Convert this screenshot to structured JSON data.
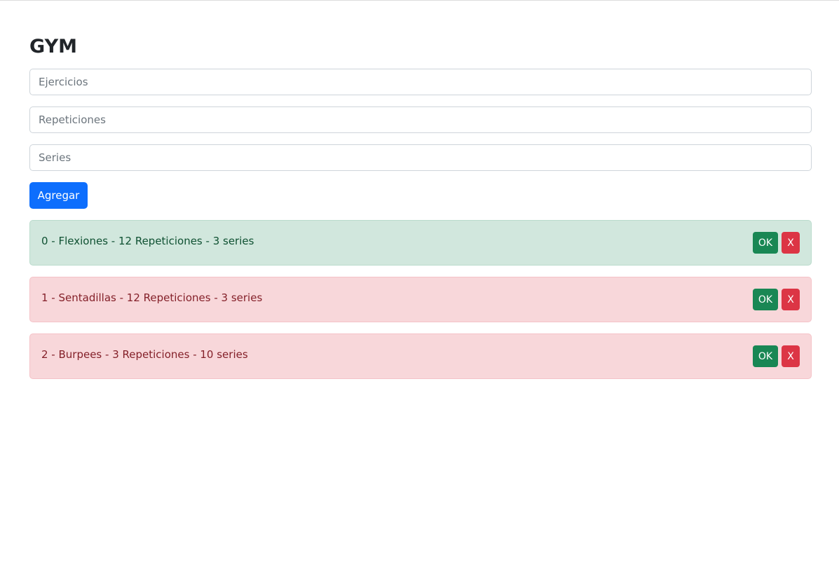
{
  "page": {
    "title": "GYM"
  },
  "form": {
    "exercise_placeholder": "Ejercicios",
    "reps_placeholder": "Repeticiones",
    "sets_placeholder": "Series",
    "add_label": "Agregar"
  },
  "items": [
    {
      "text": "0 - Flexiones - 12 Repeticiones - 3 series",
      "status": "done",
      "ok_label": "OK",
      "delete_label": "X"
    },
    {
      "text": "1 - Sentadillas - 12 Repeticiones - 3 series",
      "status": "pending",
      "ok_label": "OK",
      "delete_label": "X"
    },
    {
      "text": "2 - Burpees - 3 Repeticiones - 10 series",
      "status": "pending",
      "ok_label": "OK",
      "delete_label": "X"
    }
  ],
  "colors": {
    "primary": "#0d6efd",
    "success": "#198754",
    "danger": "#dc3545",
    "done_bg": "#d1e7dd",
    "pending_bg": "#f8d7da"
  }
}
